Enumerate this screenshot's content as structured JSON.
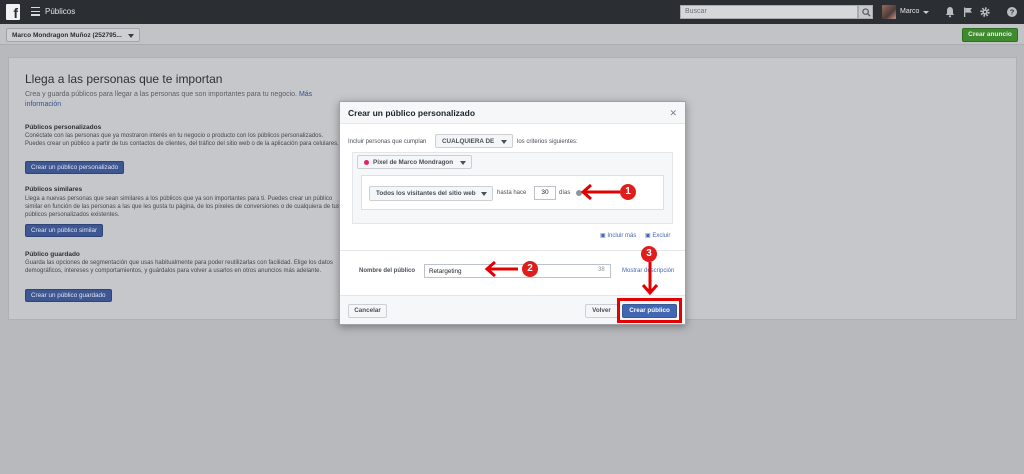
{
  "topbar": {
    "app_title": "Públicos",
    "search_placeholder": "Buscar",
    "user_name": "Marco"
  },
  "subbar": {
    "account_name": "Marco Mondragon Muñoz (252795...",
    "create_ad_label": "Crear anuncio"
  },
  "main": {
    "title": "Llega a las personas que te importan",
    "subtitle": "Crea y guarda públicos para llegar a las personas que son importantes para tu negocio.",
    "more_info_link": "Más información",
    "sections": [
      {
        "title": "Públicos personalizados",
        "description": "Conéctate con las personas que ya mostraron interés en tu negocio o producto con los públicos personalizados. Puedes crear un público a partir de tus contactos de clientes, del tráfico del sitio web o de la aplicación para celulares.",
        "button_label": "Crear un público personalizado"
      },
      {
        "title": "Públicos similares",
        "description": "Llega a nuevas personas que sean similares a los públicos que ya son importantes para ti. Puedes crear un público similar en función de las personas a las que les gusta tu página, de los píxeles de conversiones o de cualquiera de tus públicos personalizados existentes.",
        "button_label": "Crear un público similar"
      },
      {
        "title": "Público guardado",
        "description": "Guarda las opciones de segmentación que usas habitualmente para poder reutilizarlas con facilidad. Elige los datos demográficos, intereses y comportamientos, y guárdalos para volver a usarlos en otros anuncios más adelante.",
        "button_label": "Crear un público guardado"
      }
    ]
  },
  "modal": {
    "title": "Crear un público personalizado",
    "include_label": "Incluir personas que cumplan",
    "match_value": "CUALQUIERA DE",
    "criteria_suffix": "los criterios siguientes:",
    "pixel_value": "Píxel de Marco Mondragon",
    "visitors_value": "Todos los visitantes del sitio web",
    "hasta_label": "hasta hace",
    "days_value": "30",
    "days_label": "días",
    "include_more_link": "Incluir más",
    "exclude_link": "Excluir",
    "name_label": "Nombre del público",
    "name_value": "Retargeting",
    "name_char_count": "38",
    "show_description_link": "Mostrar descripción",
    "cancel_label": "Cancelar",
    "back_label": "Volver",
    "create_label": "Crear público"
  },
  "annotations": {
    "step1": "1",
    "step2": "2",
    "step3": "3",
    "arrow_color": "#e30000"
  }
}
